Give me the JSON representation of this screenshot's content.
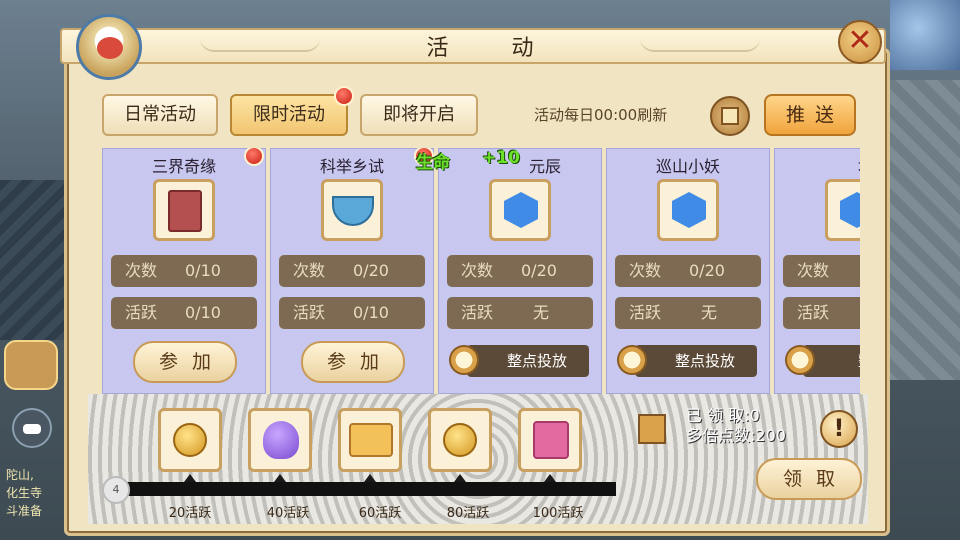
{
  "window": {
    "title": "活  动"
  },
  "tabs": [
    {
      "label": "日常活动"
    },
    {
      "label": "限时活动"
    },
    {
      "label": "即将开启"
    }
  ],
  "header": {
    "refresh_text": "活动每日00:00刷新",
    "push_label": "推送"
  },
  "float_text": {
    "left": "生命",
    "right": "+10"
  },
  "cards": [
    {
      "name": "三界奇缘",
      "icon": "book-icon",
      "count_label": "次数",
      "count": "0/10",
      "active_label": "活跃",
      "active": "0/10",
      "action": "参加"
    },
    {
      "name": "科举乡试",
      "icon": "bowl-icon",
      "count_label": "次数",
      "count": "0/20",
      "active_label": "活跃",
      "active": "0/10",
      "action": "参加"
    },
    {
      "name": "元辰",
      "icon": "gem-icon",
      "count_label": "次数",
      "count": "0/20",
      "active_label": "活跃",
      "active": "无",
      "action": "整点投放"
    },
    {
      "name": "巡山小妖",
      "icon": "gem-icon",
      "count_label": "次数",
      "count": "0/20",
      "active_label": "活跃",
      "active": "无",
      "action": "整点投放"
    },
    {
      "name": "地煞",
      "icon": "gem-icon",
      "count_label": "次数",
      "count": "",
      "active_label": "活跃",
      "active": "",
      "action": "整点"
    }
  ],
  "rewards": {
    "progress_value": "4",
    "tiers": [
      {
        "label": "20活跃",
        "icon": "coin-icon"
      },
      {
        "label": "40活跃",
        "icon": "bag-icon"
      },
      {
        "label": "60活跃",
        "icon": "scroll-icon"
      },
      {
        "label": "80活跃",
        "icon": "coin-icon"
      },
      {
        "label": "100活跃",
        "icon": "gift-icon"
      }
    ],
    "received": "已 领 取:0",
    "multiplier": "多倍点数:200",
    "claim_label": "领取"
  },
  "background_text": {
    "line1": "陀山,",
    "line2": "化生寺",
    "line3": "斗准备"
  }
}
